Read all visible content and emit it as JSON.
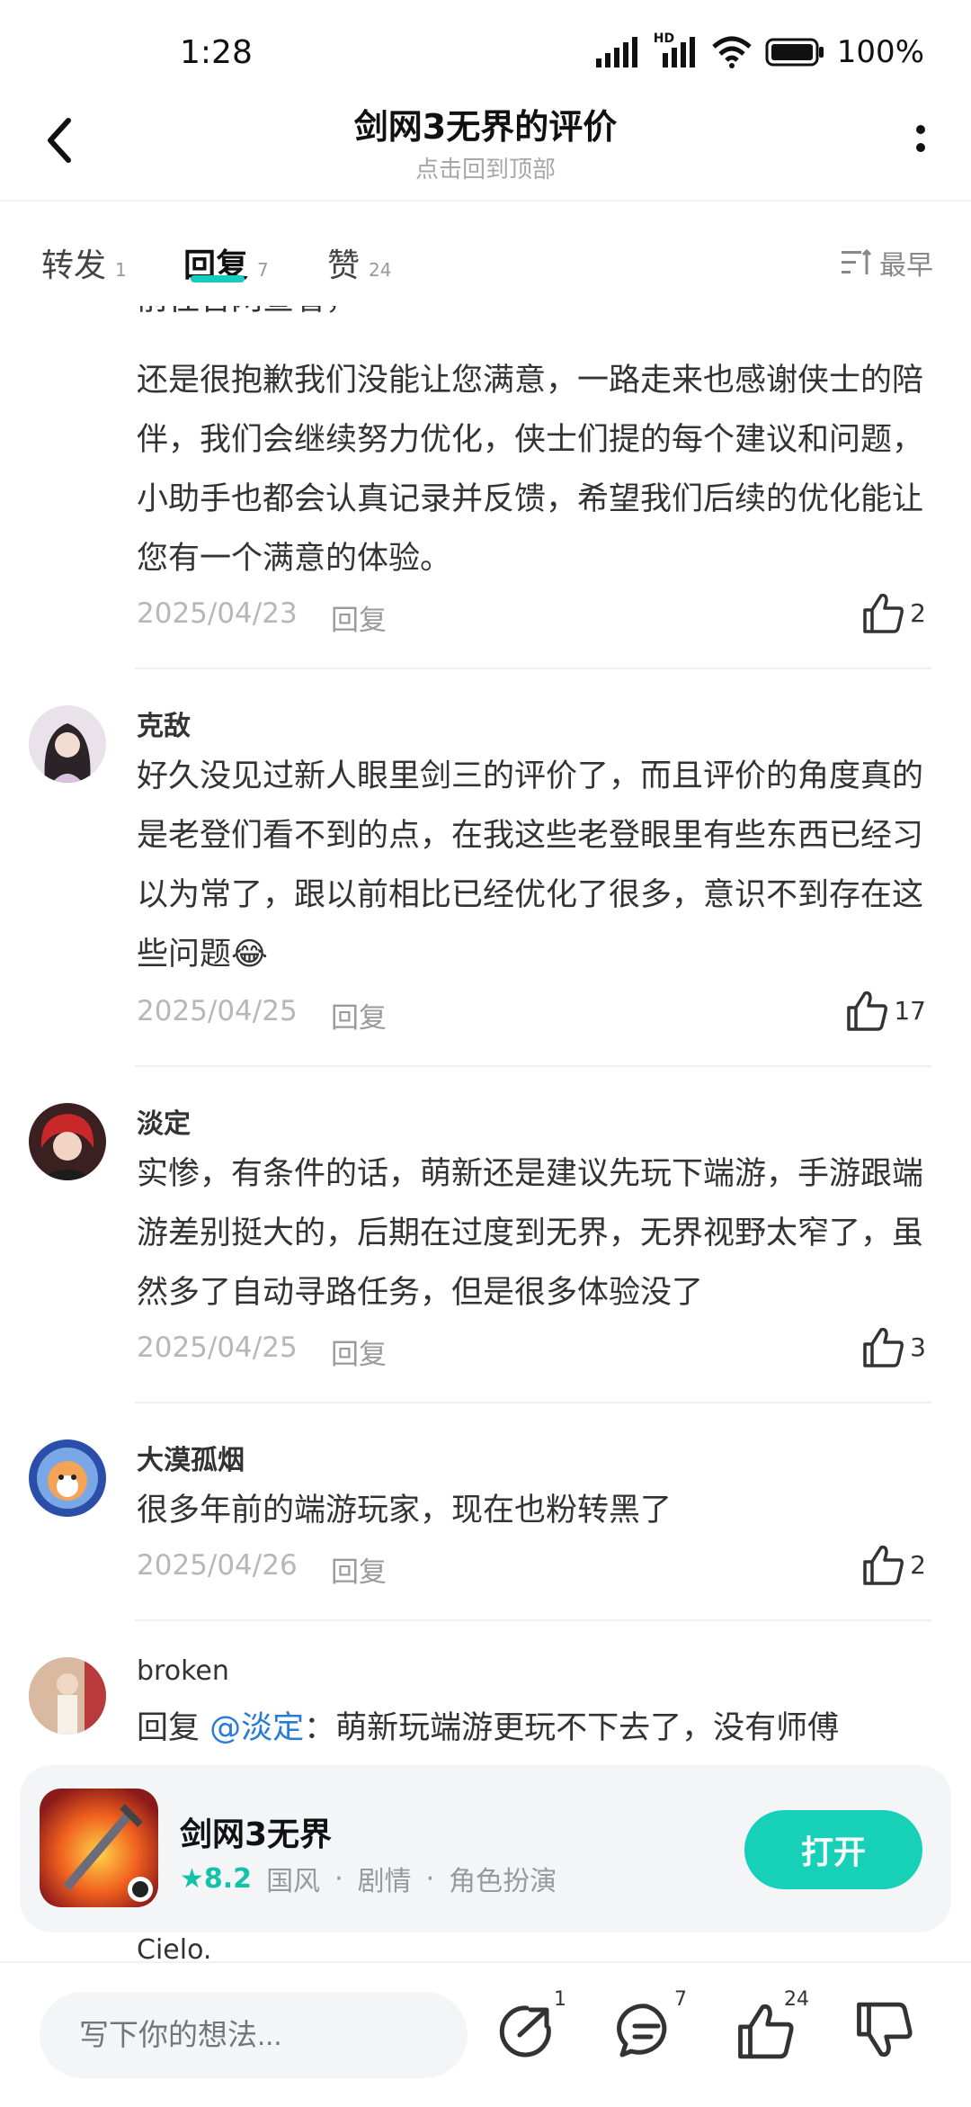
{
  "status_bar": {
    "time": "1:28",
    "hd_label": "HD",
    "battery": "100%"
  },
  "header": {
    "title": "剑网3无界的评价",
    "subtitle": "点击回到顶部"
  },
  "tabs": [
    {
      "label": "转发",
      "count": "1"
    },
    {
      "label": "回复",
      "count": "7"
    },
    {
      "label": "赞",
      "count": "24"
    }
  ],
  "sort": {
    "label": "最早"
  },
  "comments": [
    {
      "text": "还是很抱歉我们没能让您满意，一路走来也感谢侠士的陪伴，我们会继续努力优化，侠士们提的每个建议和问题，小助手也都会认真记录并反馈，希望我们后续的优化能让您有一个满意的体验。",
      "partial_line": "前往官网查看，",
      "date": "2025/04/23",
      "reply": "回复",
      "likes": "2"
    },
    {
      "author": "克敌",
      "text": "好久没见过新人眼里剑三的评价了，而且评价的角度真的是老登们看不到的点，在我这些老登眼里有些东西已经习以为常了，跟以前相比已经优化了很多，意识不到存在这些问题😂",
      "date": "2025/04/25",
      "reply": "回复",
      "likes": "17"
    },
    {
      "author": "淡定",
      "text": "实惨，有条件的话，萌新还是建议先玩下端游，手游跟端游差别挺大的，后期在过度到无界，无界视野太窄了，虽然多了自动寻路任务，但是很多体验没了",
      "date": "2025/04/25",
      "reply": "回复",
      "likes": "3"
    },
    {
      "author": "大漠孤烟",
      "text": "很多年前的端游玩家，现在也粉转黑了",
      "date": "2025/04/26",
      "reply": "回复",
      "likes": "2"
    },
    {
      "author": "broken",
      "reply_prefix": "回复",
      "mention": "@淡定",
      "text": "：萌新玩端游更玩不下去了，没有师傅"
    },
    {
      "author": "Cielo."
    }
  ],
  "app_card": {
    "name": "剑网3无界",
    "rating": "8.2",
    "tags": [
      "国风",
      "剧情",
      "角色扮演"
    ],
    "separator": "·",
    "open_label": "打开"
  },
  "bottom_bar": {
    "input_placeholder": "写下你的想法...",
    "share_count": "1",
    "comment_count": "7",
    "like_count": "24"
  },
  "colors": {
    "accent": "#17d0b8",
    "mention": "#2a7bd6",
    "muted": "#b7b7b7"
  }
}
